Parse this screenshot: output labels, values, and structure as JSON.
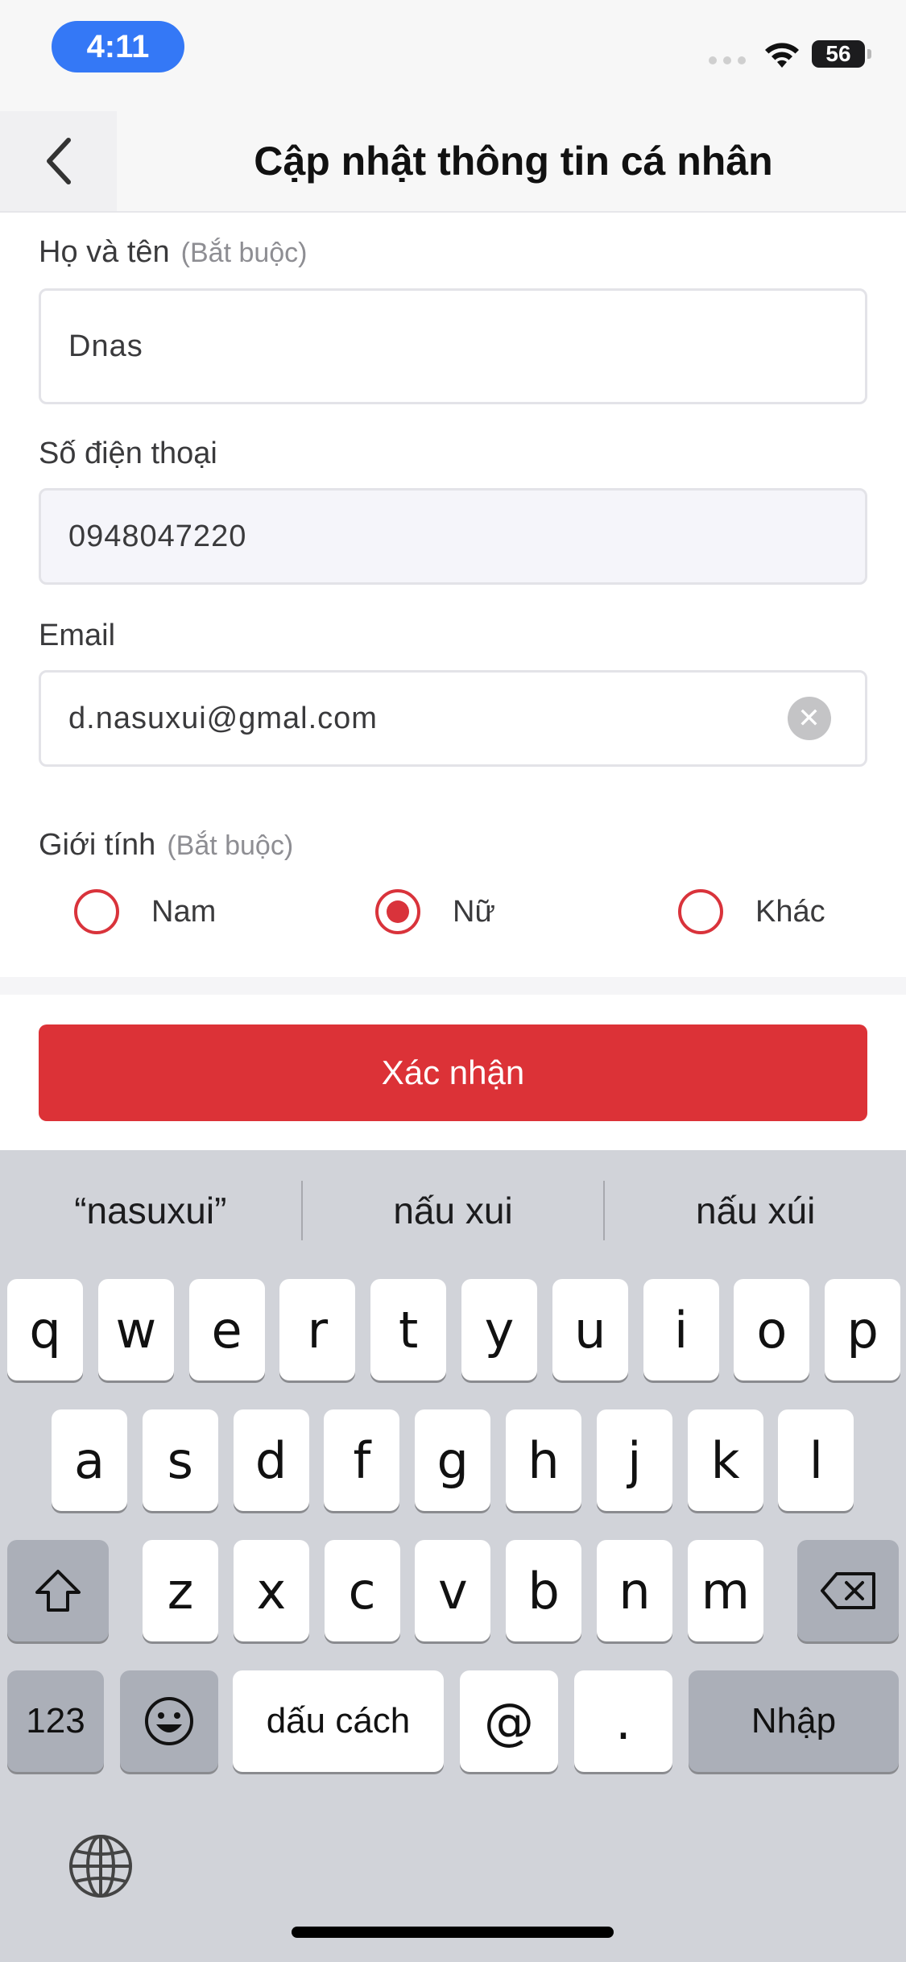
{
  "status_bar": {
    "time": "4:11",
    "battery": "56"
  },
  "nav": {
    "title": "Cập nhật thông tin cá nhân"
  },
  "form": {
    "name": {
      "label": "Họ và tên",
      "required": "(Bắt buộc)",
      "value": "Dnas"
    },
    "phone": {
      "label": "Số điện thoại",
      "value": "0948047220"
    },
    "email": {
      "label": "Email",
      "value": "d.nasuxui@gmal.com"
    },
    "gender": {
      "label": "Giới tính",
      "required": "(Bắt buộc)",
      "options": [
        {
          "label": "Nam",
          "checked": false
        },
        {
          "label": "Nữ",
          "checked": true
        },
        {
          "label": "Khác",
          "checked": false
        }
      ]
    },
    "confirm_label": "Xác nhận"
  },
  "keyboard": {
    "suggestions": [
      "“nasuxui”",
      "nấu xui",
      "nấu xúi"
    ],
    "row1": [
      "q",
      "w",
      "e",
      "r",
      "t",
      "y",
      "u",
      "i",
      "o",
      "p"
    ],
    "row2": [
      "a",
      "s",
      "d",
      "f",
      "g",
      "h",
      "j",
      "k",
      "l"
    ],
    "row3": [
      "z",
      "x",
      "c",
      "v",
      "b",
      "n",
      "m"
    ],
    "numbers_key": "123",
    "space_key": "dấu cách",
    "at_key": "@",
    "dot_key": ".",
    "return_key": "Nhập"
  },
  "colors": {
    "accent": "#dc3237",
    "time_pill": "#3478f6",
    "keyboard_bg": "#d1d3d9"
  }
}
